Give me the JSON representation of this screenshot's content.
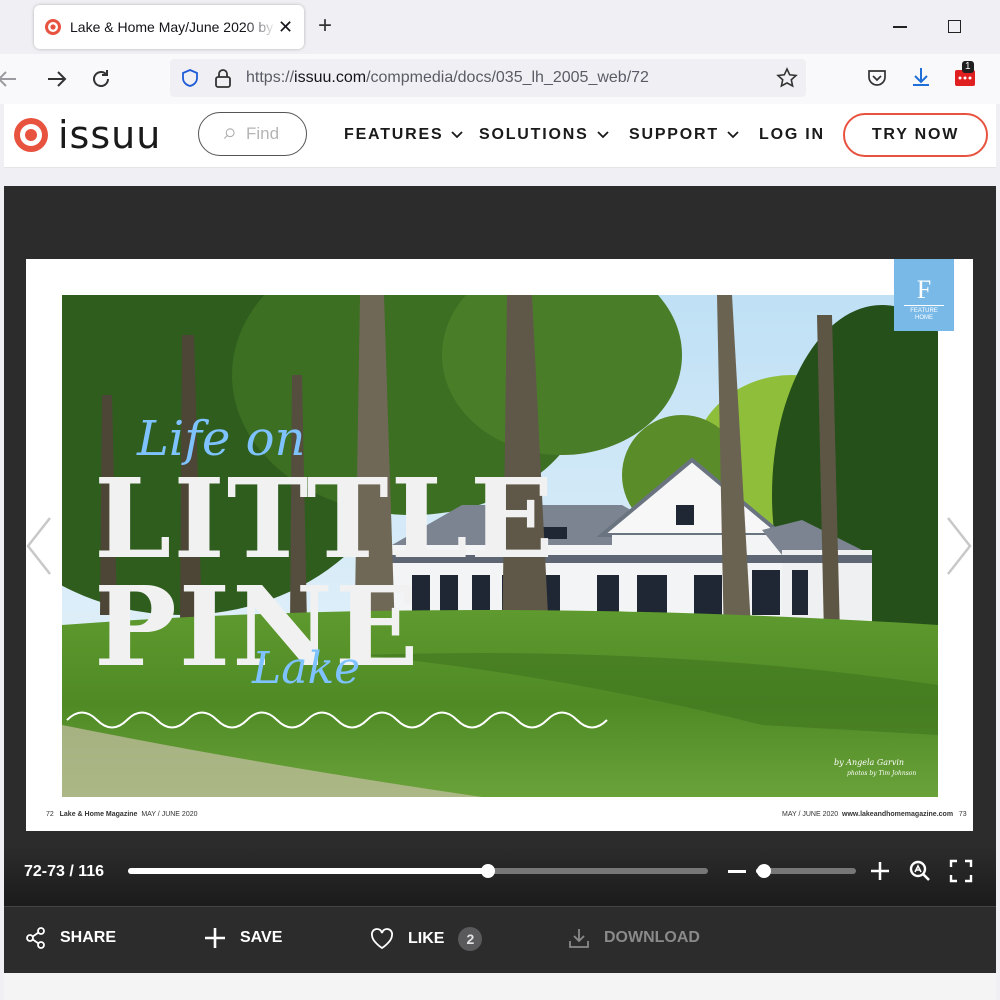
{
  "browser": {
    "tab_title": "Lake & Home May/June 2020 by",
    "new_tab": "+",
    "close": "✕",
    "url_host": "issuu.com",
    "url_path": "/compmedia/docs/035_lh_2005_web/72",
    "url_prefix": "https://",
    "extension_badge": "1"
  },
  "site": {
    "logo": "issuu",
    "search_placeholder": "Find",
    "menu": [
      {
        "label": "FEATURES"
      },
      {
        "label": "SOLUTIONS"
      },
      {
        "label": "SUPPORT"
      },
      {
        "label": "LOG IN"
      }
    ],
    "cta": "TRY NOW",
    "brand_color": "#e8533f"
  },
  "publication": {
    "script_top": "Life on",
    "title_line1": "LITTLE",
    "title_line2": "PINE",
    "script_bottom": "Lake",
    "feature_letter": "F",
    "feature_label_1": "FEATURE",
    "feature_label_2": "HOME",
    "byline": "by Angela Garvin",
    "photo_credit": "photos by Tim Johnson",
    "folio_left_num": "72",
    "folio_left_mag": "Lake & Home Magazine",
    "folio_left_date": "MAY / JUNE 2020",
    "folio_right_date": "MAY / JUNE 2020",
    "folio_right_url": "www.lakeandhomemagazine.com",
    "folio_right_num": "73"
  },
  "reader": {
    "page_count": "72-73 / 116",
    "progress": 0.62,
    "zoom": 0.08
  },
  "actions": {
    "share": "SHARE",
    "save": "SAVE",
    "like": "LIKE",
    "like_count": "2",
    "download": "DOWNLOAD"
  }
}
